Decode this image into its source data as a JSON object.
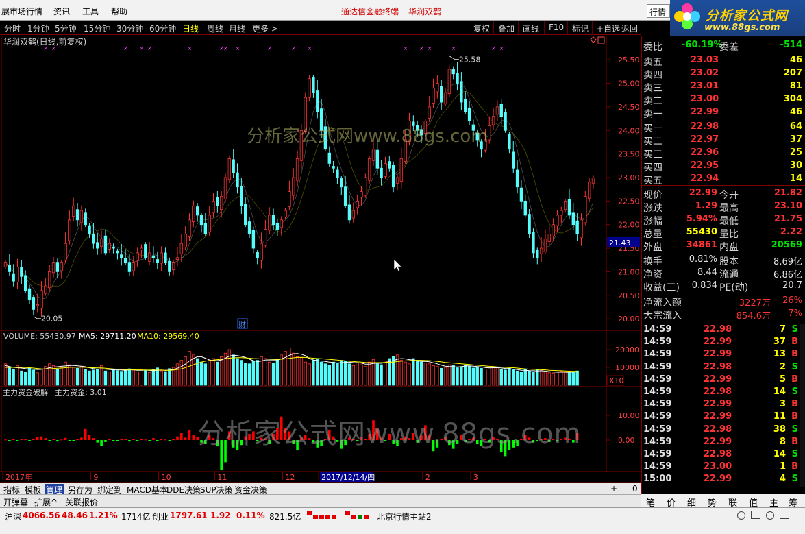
{
  "menubar": {
    "items": [
      "展市场行情",
      "资讯",
      "工具",
      "帮助"
    ],
    "center_title": "通达信金融终端",
    "stock_name": "华润双鹤",
    "search_value": "行情"
  },
  "brand": {
    "name": "分析家公式网",
    "url": "www.88gs.com",
    "ghost": "0000"
  },
  "periods": [
    "分时",
    "1分钟",
    "5分钟",
    "15分钟",
    "30分钟",
    "60分钟",
    "日线",
    "周线",
    "月线",
    "更多 >"
  ],
  "active_period": "日线",
  "toolbar": [
    "复权",
    "叠加",
    "画线",
    "F10",
    "标记",
    "+自选",
    "返回"
  ],
  "chart_title": "华润双鹤(日线,前复权)",
  "watermark": "分析家公式网www.88gs.com",
  "price_high_label": "25.58",
  "price_low_label": "20.05",
  "current_price_tag": "21.43",
  "news_badge": "财",
  "volume_header": {
    "label": "VOLUME: 55430.97",
    "ma5": "MA5: 29711.20",
    "ma10": "MA10: 29569.40"
  },
  "x10_label": "X10",
  "fund_header": {
    "name": "主力资金破解",
    "value": "主力资金: 3.01"
  },
  "date_axis": {
    "labels": [
      "2017年",
      "9",
      "10",
      "11",
      "12",
      "2017/12/14/四",
      "2",
      "3"
    ]
  },
  "colors": {
    "up": "#ff3232",
    "down": "#54fcfc",
    "ma_white": "#ffffff",
    "ma_yellow": "#ffff00",
    "fund_up": "#ff0000",
    "fund_down": "#00ff00",
    "frame": "#800000"
  },
  "chart_data": [
    {
      "type": "candlestick",
      "title": "华润双鹤(日线,前复权)",
      "ylim": [
        19.9,
        25.75
      ],
      "y_ticks": [
        "25.50",
        "25.00",
        "24.50",
        "24.00",
        "23.50",
        "23.00",
        "22.50",
        "22.00",
        "21.50",
        "21.00",
        "20.50",
        "20.00"
      ],
      "annotations": [
        {
          "text": "25.58",
          "kind": "high"
        },
        {
          "text": "20.05",
          "kind": "low"
        }
      ],
      "series": [
        {
          "values": [
            21.2,
            21.0,
            20.8,
            21.1,
            20.9,
            20.6,
            20.4,
            20.2,
            20.3,
            20.6,
            20.7,
            21.0,
            21.2,
            21.0,
            21.2,
            21.6,
            22.1,
            22.4,
            22.1,
            22.3,
            22.0,
            21.8,
            21.6,
            21.5,
            21.7,
            21.4,
            21.6,
            21.5,
            21.4,
            21.3,
            21.2,
            21.0,
            21.2,
            21.4,
            21.5,
            21.3,
            21.4,
            21.3,
            21.2,
            21.4,
            21.2,
            21.0,
            21.2,
            21.3,
            21.6,
            21.8,
            22.1,
            22.4,
            22.2,
            22.0,
            21.8,
            22.2,
            22.5,
            22.4,
            22.6,
            23.0,
            23.4,
            23.1,
            22.8,
            22.4,
            22.0,
            21.8,
            21.5,
            21.3,
            21.6,
            21.9,
            22.2,
            22.0,
            21.9,
            22.1,
            22.3,
            22.7,
            23.0,
            23.4,
            24.0,
            24.7,
            25.1,
            24.8,
            24.4,
            24.0,
            23.6,
            23.3,
            23.2,
            23.0,
            22.8,
            22.4,
            22.1,
            22.3,
            22.5,
            22.7,
            23.0,
            23.4,
            23.6,
            23.2,
            23.0,
            23.3,
            23.2,
            22.8,
            23.0,
            23.4,
            23.8,
            24.2,
            24.1,
            24.0,
            23.9,
            24.2,
            24.5,
            24.9,
            25.0,
            24.6,
            24.8,
            25.3,
            25.2,
            25.0,
            24.6,
            24.4,
            24.2,
            24.0,
            23.8,
            23.6,
            23.8,
            24.1,
            24.3,
            24.5,
            24.3,
            24.0,
            23.6,
            23.2,
            22.8,
            22.5,
            22.2,
            21.8,
            21.4,
            21.3,
            21.5,
            21.7,
            21.8,
            22.0,
            22.2,
            22.3,
            22.5,
            22.2,
            22.0,
            21.8,
            22.1,
            22.6,
            22.9,
            22.99
          ]
        }
      ]
    },
    {
      "type": "bar",
      "title": "VOLUME: 55430.97",
      "y_ticks": [
        "20000",
        "10000"
      ],
      "series": [
        {
          "name": "VOLUME",
          "values": [
            12000,
            10000,
            9000,
            11000,
            8000,
            7500,
            9500,
            8500,
            7000,
            9000,
            10500,
            12000,
            11000,
            9000,
            10000,
            13000,
            11500,
            10000,
            9500,
            10500,
            9000,
            8000,
            8500,
            9000,
            11000,
            8000,
            7500,
            9000,
            8200,
            7800,
            8800,
            9200,
            8400,
            7600,
            9100,
            8300,
            7200,
            8800,
            9700,
            8100,
            7700,
            9300,
            10000,
            12000,
            14000,
            16000,
            19000,
            17000,
            15000,
            13000,
            12000,
            14000,
            15000,
            13000,
            16000,
            18000,
            20000,
            17000,
            15000,
            14000,
            12500,
            12000,
            13500,
            14000,
            16000,
            15000,
            13000,
            12500,
            14500,
            17000,
            19000,
            21000,
            18000,
            16000,
            15500,
            13000,
            12000,
            14000,
            15000,
            13000,
            12000,
            11000,
            13000,
            12500,
            14000,
            13500,
            12000,
            11000,
            12500,
            11500,
            10500,
            13000,
            14500,
            12000,
            11500,
            13500,
            15000,
            16000,
            17000,
            14000,
            13000,
            12000,
            15000,
            14000,
            13000,
            12500,
            12000,
            11000,
            10500,
            9500,
            10000,
            11500,
            11000,
            9800,
            10500,
            11200,
            10800,
            9600,
            10400,
            9500,
            9000,
            10000,
            10200,
            9800,
            9000,
            8500,
            9500,
            8800,
            8000,
            7500,
            9000,
            8000,
            7500,
            8500,
            8200,
            7600,
            7000,
            6800,
            7400,
            7800,
            7200,
            6900,
            7500,
            8000
          ]
        },
        {
          "name": "MA5",
          "values": [
            11000,
            10500,
            10000,
            9800,
            9600,
            9300,
            9100,
            9000,
            8800,
            8900,
            9200,
            9800,
            10200,
            10400,
            10600,
            10800,
            11000,
            11100,
            10900,
            10700,
            10400,
            9800,
            9300,
            9000,
            9100,
            9000,
            8800,
            8600,
            8600,
            8500,
            8400,
            8600,
            8600,
            8400,
            8400,
            8500,
            8300,
            8200,
            8400,
            8500,
            8300,
            8500,
            8800,
            9500,
            10500,
            11900,
            13600,
            15000,
            16000,
            16000,
            15200,
            14200,
            13800,
            13800,
            14200,
            15200,
            16400,
            16800,
            16600,
            16200,
            15600,
            14600,
            13800,
            13200,
            13600,
            14200,
            14200,
            14200,
            14200,
            14800,
            15600,
            16800,
            17600,
            17800,
            17400,
            16600,
            15000,
            14200,
            13800,
            13600,
            13400,
            13000,
            12800,
            12500,
            12700,
            12800,
            13000,
            12700,
            12600,
            12400,
            11800,
            11800,
            12200,
            12400,
            12300,
            12800,
            13300,
            13800,
            14600,
            15000,
            14800,
            14400,
            14200,
            13600,
            13400,
            13400,
            13200,
            12600,
            12000,
            11200,
            10700,
            10500,
            10400,
            10300,
            10400,
            10800,
            10900,
            10700,
            10500,
            10300,
            9900,
            9700,
            9800,
            9800,
            9700,
            9400,
            9300,
            9000,
            8800,
            8400,
            8400,
            8200,
            8100,
            8000,
            8100,
            7900,
            7600,
            7400,
            7300,
            7300,
            7300,
            7200,
            7400,
            7500
          ]
        },
        {
          "name": "MA10",
          "values": [
            10000,
            10000,
            10000,
            10000,
            10000,
            9900,
            9800,
            9600,
            9400,
            9200,
            9100,
            9200,
            9400,
            9500,
            9600,
            9800,
            10000,
            10100,
            10100,
            10100,
            10000,
            9900,
            9800,
            9700,
            9700,
            9500,
            9300,
            9100,
            9000,
            8900,
            8800,
            8700,
            8700,
            8600,
            8600,
            8500,
            8500,
            8500,
            8500,
            8500,
            8400,
            8400,
            8500,
            8800,
            9200,
            9900,
            10700,
            11500,
            12300,
            13000,
            13500,
            13800,
            14100,
            14400,
            14600,
            14900,
            15200,
            15400,
            15500,
            15500,
            15400,
            15200,
            15000,
            14900,
            14800,
            14800,
            14700,
            14600,
            14500,
            14600,
            14800,
            15100,
            15400,
            15600,
            15700,
            15600,
            15400,
            15200,
            15000,
            14900,
            14700,
            14500,
            14300,
            14100,
            13900,
            13700,
            13500,
            13300,
            13100,
            13000,
            12800,
            12700,
            12700,
            12700,
            12700,
            12800,
            12900,
            13000,
            13300,
            13500,
            13700,
            13800,
            13900,
            14000,
            14000,
            13900,
            13800,
            13600,
            13400,
            13100,
            12800,
            12600,
            12400,
            12200,
            12000,
            11800,
            11600,
            11400,
            11200,
            11000,
            10800,
            10600,
            10500,
            10300,
            10200,
            10000,
            9900,
            9800,
            9600,
            9400,
            9200,
            9000,
            8900,
            8800,
            8700,
            8600,
            8400,
            8300,
            8200,
            8100,
            8000,
            7900,
            7800,
            7800
          ]
        }
      ]
    },
    {
      "type": "bar",
      "title": "主力资金破解",
      "y_ticks": [
        "10.00",
        "0.00"
      ],
      "series": [
        {
          "name": "主力资金",
          "values": [
            0.2,
            -0.3,
            0.4,
            -0.2,
            0.5,
            0.3,
            -0.4,
            0.6,
            1.2,
            1.5,
            0.8,
            -0.5,
            0.3,
            -0.6,
            0.2,
            0.9,
            -0.3,
            -0.4,
            0.5,
            1.0,
            4.5,
            2.0,
            0.8,
            -1.0,
            -2.5,
            -0.8,
            0.4,
            -0.5,
            -0.3,
            0.6,
            0.4,
            -0.6,
            0.5,
            -0.4,
            0.3,
            0.2,
            -0.3,
            0.8,
            -0.4,
            0.3,
            0.2,
            -0.5,
            0.4,
            1.5,
            2.8,
            1.0,
            4.0,
            2.0,
            1.2,
            -1.0,
            -1.5,
            2.0,
            0.8,
            -2.5,
            -12.0,
            -9.0,
            3.5,
            -3.0,
            -4.0,
            -2.0,
            1.5,
            2.5,
            3.5,
            -0.5,
            1.0,
            0.6,
            -1.5,
            2.5,
            5.0,
            9.5,
            5.0,
            3.5,
            -1.5,
            -4.0,
            1.0,
            2.0,
            0.8,
            -1.0,
            -3.0,
            -2.5,
            0.5,
            4.0,
            1.5,
            -0.8,
            -3.5,
            -2.0,
            1.0,
            0.5,
            -0.5,
            1.2,
            0.5,
            2.5,
            8.0,
            4.5,
            1.0,
            -0.5,
            2.5,
            -1.5,
            -2.5,
            0.8,
            1.5,
            0.8,
            3.0,
            -1.0,
            1.8,
            6.0,
            2.0,
            -4.5,
            -3.0,
            0.5,
            1.0,
            -2.0,
            -3.5,
            -1.5,
            2.0,
            -0.8,
            0.5,
            1.0,
            -1.5,
            -2.5,
            0.5,
            -1.0,
            1.2,
            0.5,
            -5.0,
            -6.5,
            -4.0,
            -3.0,
            -2.5,
            0.5,
            2.0,
            1.0,
            -1.0,
            -0.5,
            0.5,
            0.8,
            -0.8,
            0.5,
            -0.6,
            0.4,
            1.0,
            0.6,
            -1.0,
            3.01
          ]
        }
      ]
    }
  ],
  "quote": {
    "weibi_label": "委比",
    "weibi_value": "-60.19%",
    "weicha_label": "委差",
    "weicha_value": "-514",
    "sell": [
      {
        "label": "卖五",
        "price": "23.03",
        "vol": "46"
      },
      {
        "label": "卖四",
        "price": "23.02",
        "vol": "207"
      },
      {
        "label": "卖三",
        "price": "23.01",
        "vol": "81"
      },
      {
        "label": "卖二",
        "price": "23.00",
        "vol": "304"
      },
      {
        "label": "卖一",
        "price": "22.99",
        "vol": "46"
      }
    ],
    "buy": [
      {
        "label": "买一",
        "price": "22.98",
        "vol": "64"
      },
      {
        "label": "买二",
        "price": "22.97",
        "vol": "37"
      },
      {
        "label": "买三",
        "price": "22.96",
        "vol": "25"
      },
      {
        "label": "买四",
        "price": "22.95",
        "vol": "30"
      },
      {
        "label": "买五",
        "price": "22.94",
        "vol": "14"
      }
    ],
    "stats": [
      {
        "l1": "现价",
        "v1": "22.99",
        "c1": "red",
        "l2": "今开",
        "v2": "21.82",
        "c2": "red"
      },
      {
        "l1": "涨跌",
        "v1": "1.29",
        "c1": "red",
        "l2": "最高",
        "v2": "23.10",
        "c2": "red"
      },
      {
        "l1": "涨幅",
        "v1": "5.94%",
        "c1": "red",
        "l2": "最低",
        "v2": "21.75",
        "c2": "red"
      },
      {
        "l1": "总量",
        "v1": "55430",
        "c1": "yel",
        "l2": "量比",
        "v2": "2.22",
        "c2": "red"
      },
      {
        "l1": "外盘",
        "v1": "34861",
        "c1": "red",
        "l2": "内盘",
        "v2": "20569",
        "c2": "grn"
      }
    ],
    "stats2": [
      {
        "l1": "换手",
        "v1": "0.81%",
        "l2": "股本",
        "v2": "8.69亿"
      },
      {
        "l1": "净资",
        "v1": "8.44",
        "l2": "流通",
        "v2": "6.86亿"
      },
      {
        "l1": "收益(三)",
        "v1": "0.834",
        "l2": "PE(动)",
        "v2": "20.7"
      }
    ],
    "flow": [
      {
        "l": "净流入额",
        "v": "3227万",
        "p": "26%"
      },
      {
        "l": "大宗流入",
        "v": "854.6万",
        "p": "7%"
      }
    ]
  },
  "ticks": [
    {
      "t": "14:59",
      "p": "22.98",
      "v": "7",
      "s": "S"
    },
    {
      "t": "14:59",
      "p": "22.99",
      "v": "37",
      "s": "B"
    },
    {
      "t": "14:59",
      "p": "22.99",
      "v": "13",
      "s": "B"
    },
    {
      "t": "14:59",
      "p": "22.98",
      "v": "2",
      "s": "S"
    },
    {
      "t": "14:59",
      "p": "22.99",
      "v": "5",
      "s": "B"
    },
    {
      "t": "14:59",
      "p": "22.98",
      "v": "14",
      "s": "S"
    },
    {
      "t": "14:59",
      "p": "22.99",
      "v": "3",
      "s": "B"
    },
    {
      "t": "14:59",
      "p": "22.99",
      "v": "11",
      "s": "B"
    },
    {
      "t": "14:59",
      "p": "22.98",
      "v": "38",
      "s": "S"
    },
    {
      "t": "14:59",
      "p": "22.99",
      "v": "8",
      "s": "B"
    },
    {
      "t": "14:59",
      "p": "22.98",
      "v": "14",
      "s": "S"
    },
    {
      "t": "14:59",
      "p": "23.00",
      "v": "1",
      "s": "B"
    },
    {
      "t": "15:00",
      "p": "22.99",
      "v": "4",
      "s": "S"
    }
  ],
  "right_tabs": [
    "笔",
    "价",
    "细",
    "势",
    "联",
    "值",
    "主",
    "筹"
  ],
  "bottom_tabs": [
    "指标",
    "模板",
    "管理",
    "另存为",
    "绑定到",
    "MACD基本",
    "DDE决策",
    "SUP决策",
    "资金决策"
  ],
  "bottom_tabs_active": "管理",
  "bottom_tabs2": [
    "开弹幕",
    "扩展^",
    "关联报价"
  ],
  "zoom_controls": [
    "+",
    "-",
    "0"
  ],
  "status": {
    "sh_label": "沪深",
    "sh_index": "4066.56",
    "sh_chg": "48.46",
    "sh_pct": "1.21%",
    "sh_amt": "1714亿",
    "cy_label": "创业",
    "cy_index": "1797.61",
    "cy_chg": "1.92",
    "cy_pct": "0.11%",
    "cy_amt": "821.5亿",
    "server": "北京行情主站2"
  }
}
